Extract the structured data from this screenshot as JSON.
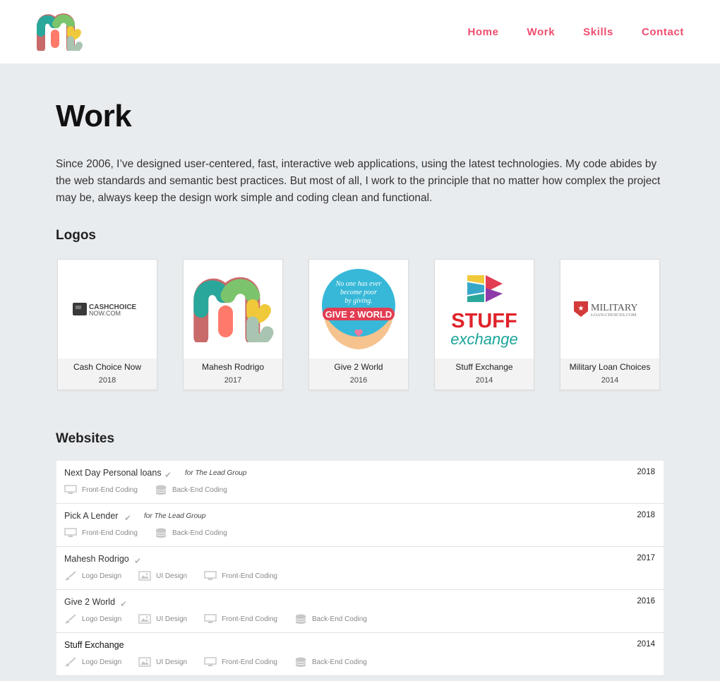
{
  "nav": {
    "items": [
      "Home",
      "Work",
      "Skills",
      "Contact"
    ]
  },
  "page": {
    "title": "Work",
    "intro": "Since 2006, I’ve designed user-centered, fast, interactive web applications, using the latest technologies. My code abides by the web standards and semantic best practices. But most of all, I work to the principle that no matter how complex the project may be, always keep the design work simple and coding clean and functional."
  },
  "logos": {
    "title": "Logos",
    "items": [
      {
        "name": "Cash Choice Now",
        "year": "2018",
        "art": {
          "line1": "CASHCHOICE",
          "line2": "NOW.COM"
        }
      },
      {
        "name": "Mahesh Rodrigo",
        "year": "2017"
      },
      {
        "name": "Give 2 World",
        "year": "2016",
        "art": {
          "line1": "No one has ever",
          "line2": "become poor",
          "line3": "by giving.",
          "wordmark": "GIVE 2 WORLD"
        }
      },
      {
        "name": "Stuff Exchange",
        "year": "2014",
        "art": {
          "line1": "STUFF",
          "line2": "exchange"
        }
      },
      {
        "name": "Military Loan Choices",
        "year": "2014",
        "art": {
          "line1": "MILITARY",
          "line2": "LOAN-CHOICES.COM"
        }
      }
    ]
  },
  "websites": {
    "title": "Websites",
    "check_glyph": "✔",
    "items": [
      {
        "name": "Next Day Personal loans",
        "client": "for The Lead Group",
        "year": "2018",
        "tags": [
          {
            "icon": "monitor-icon",
            "label": "Front-End Coding"
          },
          {
            "icon": "database-icon",
            "label": "Back-End Coding"
          }
        ]
      },
      {
        "name": "Pick A Lender",
        "client": "for The Lead Group",
        "year": "2018",
        "tags": [
          {
            "icon": "monitor-icon",
            "label": "Front-End Coding"
          },
          {
            "icon": "database-icon",
            "label": "Back-End Coding"
          }
        ]
      },
      {
        "name": "Mahesh Rodrigo",
        "client": "",
        "year": "2017",
        "tags": [
          {
            "icon": "brush-icon",
            "label": "Logo Design"
          },
          {
            "icon": "image-icon",
            "label": "UI Design"
          },
          {
            "icon": "monitor-icon",
            "label": "Front-End Coding"
          }
        ]
      },
      {
        "name": "Give 2 World",
        "client": "",
        "year": "2016",
        "tags": [
          {
            "icon": "brush-icon",
            "label": "Logo Design"
          },
          {
            "icon": "image-icon",
            "label": "UI Design"
          },
          {
            "icon": "monitor-icon",
            "label": "Front-End Coding"
          },
          {
            "icon": "database-icon",
            "label": "Back-End Coding"
          }
        ]
      },
      {
        "name": "Stuff Exchange",
        "client": "",
        "year": "2014",
        "tags": [
          {
            "icon": "brush-icon",
            "label": "Logo Design"
          },
          {
            "icon": "image-icon",
            "label": "UI Design"
          },
          {
            "icon": "monitor-icon",
            "label": "Front-End Coding"
          },
          {
            "icon": "database-icon",
            "label": "Back-End Coding"
          }
        ]
      }
    ]
  },
  "colors": {
    "accent": "#ef4d6e",
    "page_bg": "#e9ecef",
    "card_bg": "#f3f3f3"
  }
}
